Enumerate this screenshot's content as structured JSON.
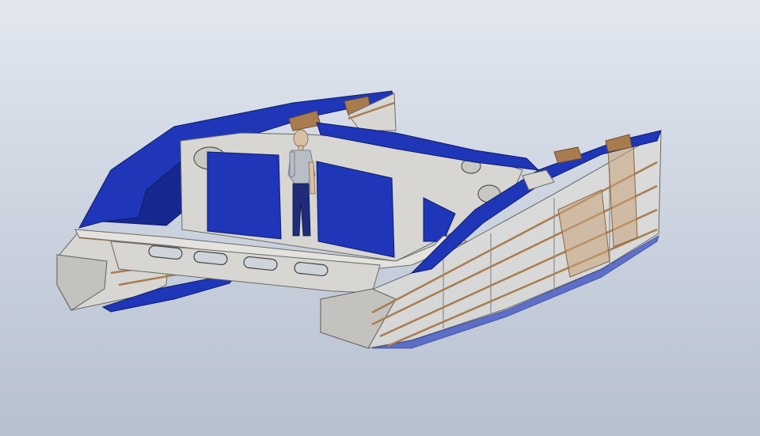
{
  "colors": {
    "background_top": "#e2e7ef",
    "background_bottom": "#b7c0cf",
    "hull_blue": "#1f36b8",
    "hull_blue_dark": "#16288f",
    "panel_grey": "#d7d6d2",
    "panel_grey_dark": "#bdbcb8",
    "wood": "#a97c4f",
    "wood_light": "#c9a37a",
    "figure_shirt": "#b9bec6",
    "figure_pants": "#1e2c7a",
    "figure_skin": "#d8c0a4"
  },
  "scene": {
    "subject": "catamaran-hull-cad-model",
    "icons": [
      "catamaran-model",
      "human-figure"
    ]
  }
}
